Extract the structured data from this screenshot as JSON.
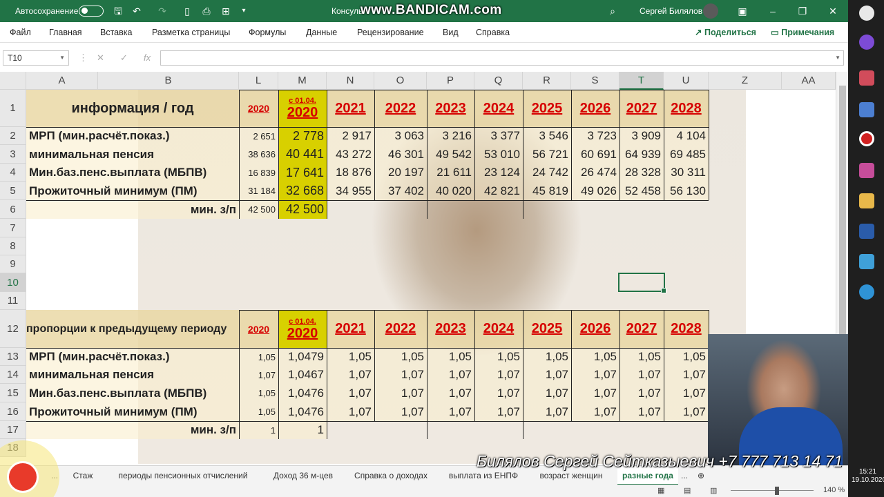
{
  "titlebar": {
    "autosave_label": "Автосохранение",
    "file_title": "Консуль",
    "watermark": "www.BANDICAM.com",
    "user_name": "Сергей Билялов",
    "win_icons": [
      "restore-ribbon-icon",
      "minimize-icon",
      "maximize-icon",
      "close-icon"
    ]
  },
  "ribbon": {
    "tabs": [
      "Файл",
      "Главная",
      "Вставка",
      "Разметка страницы",
      "Формулы",
      "Данные",
      "Рецензирование",
      "Вид",
      "Справка"
    ],
    "share_label": "Поделиться",
    "comments_label": "Примечания"
  },
  "formula_bar": {
    "name_box": "T10",
    "fx_label": "fx",
    "value": ""
  },
  "columns": [
    "A",
    "B",
    "L",
    "M",
    "N",
    "O",
    "P",
    "Q",
    "R",
    "S",
    "T",
    "U",
    "Z",
    "AA"
  ],
  "rows": [
    "1",
    "2",
    "3",
    "4",
    "5",
    "6",
    "7",
    "8",
    "9",
    "10",
    "11",
    "12",
    "13",
    "14",
    "15",
    "16",
    "17",
    "18"
  ],
  "table1": {
    "header_label": "информация / год",
    "l_year": "2020",
    "m_prefix": "с 01.04.",
    "m_year": "2020",
    "years": [
      "2021",
      "2022",
      "2023",
      "2024",
      "2025",
      "2026",
      "2027",
      "2028"
    ],
    "rows": [
      {
        "label": "МРП (мин.расчёт.показ.)",
        "l": "2 651",
        "m": "2 778",
        "values": [
          "2 917",
          "3 063",
          "3 216",
          "3 377",
          "3 546",
          "3 723",
          "3 909",
          "4 104"
        ]
      },
      {
        "label": "минимальная пенсия",
        "l": "38 636",
        "m": "40 441",
        "values": [
          "43 272",
          "46 301",
          "49 542",
          "53 010",
          "56 721",
          "60 691",
          "64 939",
          "69 485"
        ]
      },
      {
        "label": "Мин.баз.пенс.выплата (МБПВ)",
        "l": "16 839",
        "m": "17 641",
        "values": [
          "18 876",
          "20 197",
          "21 611",
          "23 124",
          "24 742",
          "26 474",
          "28 328",
          "30 311"
        ]
      },
      {
        "label": "Прожиточный минимум (ПМ)",
        "l": "31 184",
        "m": "32 668",
        "values": [
          "34 955",
          "37 402",
          "40 020",
          "42 821",
          "45 819",
          "49 026",
          "52 458",
          "56 130"
        ]
      }
    ],
    "min_wage_label": "мин. з/п",
    "min_wage_l": "42 500",
    "min_wage_m": "42 500"
  },
  "table2": {
    "header_label": "пропорции к предыдущему периоду",
    "l_year": "2020",
    "m_prefix": "с 01.04.",
    "m_year": "2020",
    "years": [
      "2021",
      "2022",
      "2023",
      "2024",
      "2025",
      "2026",
      "2027",
      "2028"
    ],
    "rows": [
      {
        "label": "МРП (мин.расчёт.показ.)",
        "l": "1,05",
        "m": "1,0479",
        "values": [
          "1,05",
          "1,05",
          "1,05",
          "1,05",
          "1,05",
          "1,05",
          "1,05",
          "1,05"
        ]
      },
      {
        "label": "минимальная пенсия",
        "l": "1,07",
        "m": "1,0467",
        "values": [
          "1,07",
          "1,07",
          "1,07",
          "1,07",
          "1,07",
          "1,07",
          "1,07",
          "1,07"
        ]
      },
      {
        "label": "Мин.баз.пенс.выплата (МБПВ)",
        "l": "1,05",
        "m": "1,0476",
        "values": [
          "1,07",
          "1,07",
          "1,07",
          "1,07",
          "1,07",
          "1,07",
          "1,07",
          "1,07"
        ]
      },
      {
        "label": "Прожиточный минимум (ПМ)",
        "l": "1,05",
        "m": "1,0476",
        "values": [
          "1,07",
          "1,07",
          "1,07",
          "1,07",
          "1,07",
          "1,07",
          "1,07",
          "1,07"
        ]
      }
    ],
    "min_wage_label": "мин. з/п",
    "min_wage_l": "1",
    "min_wage_m": "1"
  },
  "sheet_tabs": {
    "overflow": "...",
    "tabs": [
      "Стаж",
      "периоды пенсионных отчислений",
      "Доход 36 м-цев",
      "Справка о доходах",
      "выплата из ЕНПФ",
      "возраст женщин",
      "разные года"
    ],
    "active": "разные года",
    "more": "..."
  },
  "status": {
    "zoom": "140 %"
  },
  "system_tray": {
    "time": "15:21",
    "date": "19.10.2020"
  },
  "video_overlay": {
    "caption": "Билялов Сергей Сейтказыевич +7 777 713 14 71"
  },
  "colors": {
    "excel_green": "#217346",
    "year_red": "#d60000",
    "highlight": "#d8d000"
  }
}
